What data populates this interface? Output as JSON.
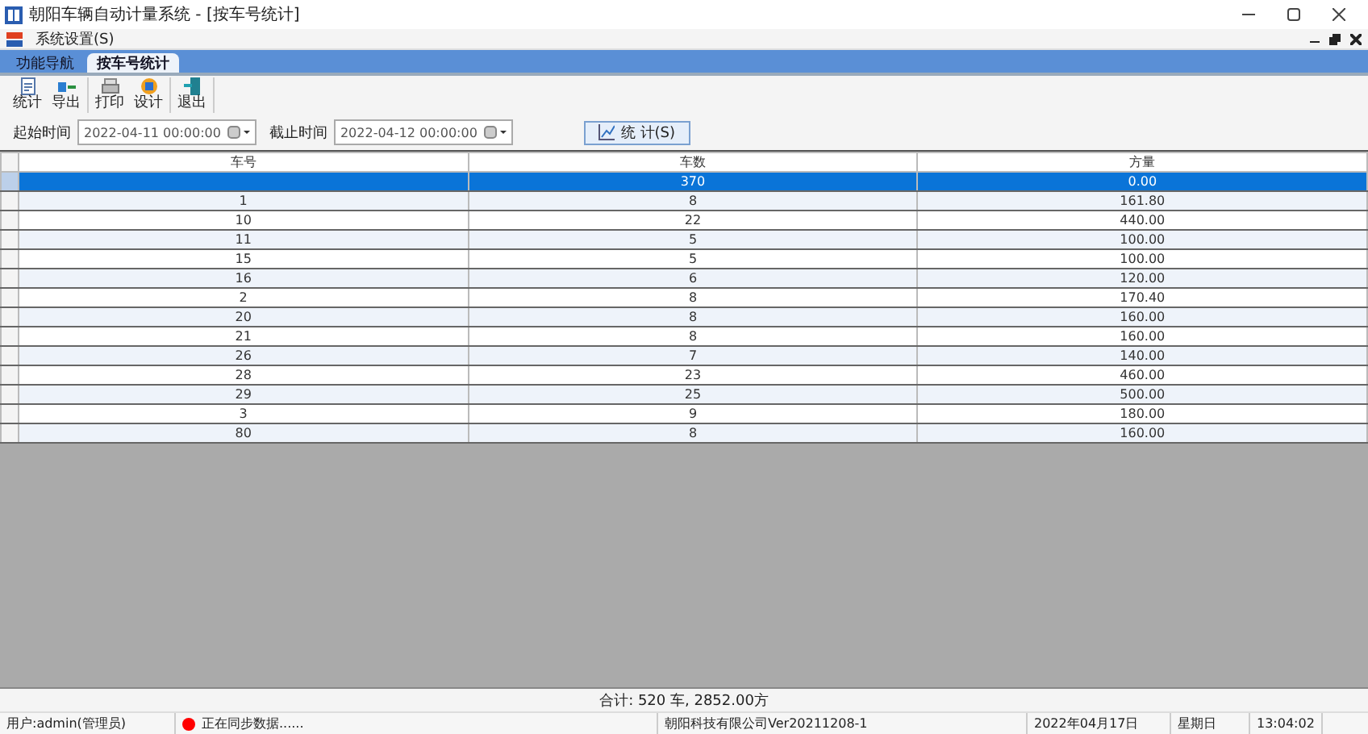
{
  "window": {
    "title": "朝阳车辆自动计量系统 - [按车号统计]"
  },
  "menu": [
    {
      "label": "系统设置(S)"
    }
  ],
  "tabs": [
    {
      "label": "功能导航",
      "selected": false
    },
    {
      "label": "按车号统计",
      "selected": true
    }
  ],
  "toolbar": [
    {
      "buttons": [
        {
          "label": "统计",
          "kind": "stats"
        },
        {
          "label": "导出",
          "kind": "export"
        }
      ]
    },
    {
      "buttons": [
        {
          "label": "打印",
          "kind": "print"
        },
        {
          "label": "设计",
          "kind": "design"
        }
      ]
    },
    {
      "buttons": [
        {
          "label": "退出",
          "kind": "exit"
        }
      ]
    }
  ],
  "filters": [
    {
      "label": "起始时间",
      "value": "2022-04-11 00:00:00"
    },
    {
      "label": "截止时间",
      "value": "2022-04-12 00:00:00"
    }
  ],
  "query_button": "统 计(S)",
  "table": {
    "columns": [
      "车号",
      "车数",
      "方量"
    ],
    "rows": [
      {
        "cells": [
          "",
          "370",
          "0.00"
        ],
        "selected": true
      },
      {
        "cells": [
          "1",
          "8",
          "161.80"
        ],
        "selected": false
      },
      {
        "cells": [
          "10",
          "22",
          "440.00"
        ],
        "selected": false
      },
      {
        "cells": [
          "11",
          "5",
          "100.00"
        ],
        "selected": false
      },
      {
        "cells": [
          "15",
          "5",
          "100.00"
        ],
        "selected": false
      },
      {
        "cells": [
          "16",
          "6",
          "120.00"
        ],
        "selected": false
      },
      {
        "cells": [
          "2",
          "8",
          "170.40"
        ],
        "selected": false
      },
      {
        "cells": [
          "20",
          "8",
          "160.00"
        ],
        "selected": false
      },
      {
        "cells": [
          "21",
          "8",
          "160.00"
        ],
        "selected": false
      },
      {
        "cells": [
          "26",
          "7",
          "140.00"
        ],
        "selected": false
      },
      {
        "cells": [
          "28",
          "23",
          "460.00"
        ],
        "selected": false
      },
      {
        "cells": [
          "29",
          "25",
          "500.00"
        ],
        "selected": false
      },
      {
        "cells": [
          "3",
          "9",
          "180.00"
        ],
        "selected": false
      },
      {
        "cells": [
          "80",
          "8",
          "160.00"
        ],
        "selected": false
      }
    ]
  },
  "total": "合计: 520 车, 2852.00方",
  "status_bar": [
    {
      "text": "用户:admin(管理员)",
      "kind": "plain"
    },
    {
      "text": "正在同步数据......",
      "kind": "sync",
      "color": "#ff0000"
    },
    {
      "text": "朝阳科技有限公司Ver20211208-1",
      "kind": "plain"
    },
    {
      "text": "2022年04月17日",
      "kind": "plain"
    },
    {
      "text": "星期日",
      "kind": "plain"
    },
    {
      "text": "13:04:02",
      "kind": "plain"
    }
  ]
}
